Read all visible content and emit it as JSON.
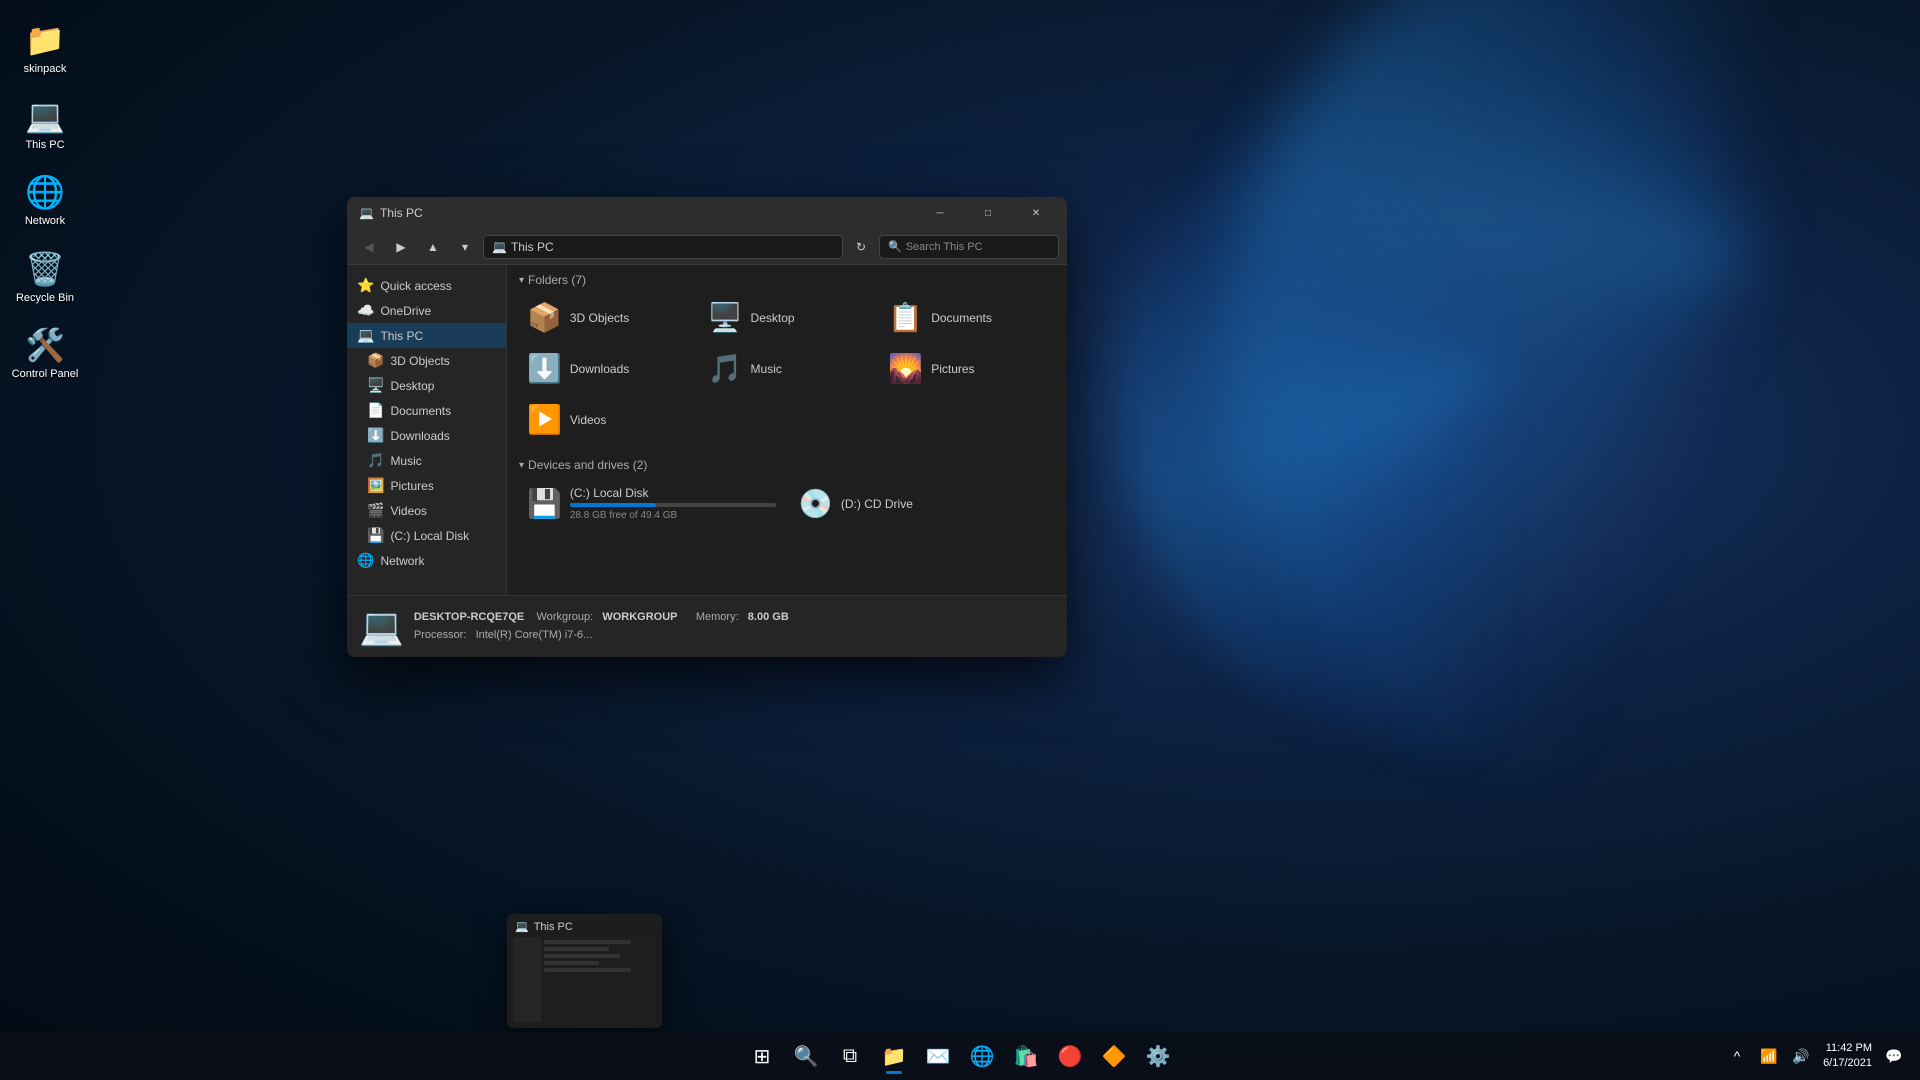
{
  "desktop": {
    "background": "Windows 11 blue swirl",
    "icons": [
      {
        "id": "skinpack",
        "label": "skinpack",
        "emoji": "📁",
        "color": "#f0a030"
      },
      {
        "id": "this-pc",
        "label": "This PC",
        "emoji": "💻"
      },
      {
        "id": "network",
        "label": "Network",
        "emoji": "🌐"
      },
      {
        "id": "recycle-bin",
        "label": "Recycle Bin",
        "emoji": "🗑️"
      },
      {
        "id": "control-panel",
        "label": "Control Panel",
        "emoji": "🛠️"
      }
    ]
  },
  "explorer": {
    "title": "This PC",
    "address": "This PC",
    "search_placeholder": "Search This PC",
    "sidebar": {
      "items": [
        {
          "id": "quick-access",
          "label": "Quick access",
          "icon": "⭐",
          "indent": 0
        },
        {
          "id": "onedrive",
          "label": "OneDrive",
          "icon": "☁️",
          "indent": 1
        },
        {
          "id": "this-pc",
          "label": "This PC",
          "icon": "💻",
          "indent": 1
        },
        {
          "id": "3d-objects",
          "label": "3D Objects",
          "icon": "📦",
          "indent": 2
        },
        {
          "id": "desktop",
          "label": "Desktop",
          "icon": "🖥️",
          "indent": 2
        },
        {
          "id": "documents",
          "label": "Documents",
          "icon": "📄",
          "indent": 2
        },
        {
          "id": "downloads",
          "label": "Downloads",
          "icon": "⬇️",
          "indent": 2
        },
        {
          "id": "music",
          "label": "Music",
          "icon": "🎵",
          "indent": 2
        },
        {
          "id": "pictures",
          "label": "Pictures",
          "icon": "🖼️",
          "indent": 2
        },
        {
          "id": "videos",
          "label": "Videos",
          "icon": "🎬",
          "indent": 2
        },
        {
          "id": "local-disk",
          "label": "(C:) Local Disk",
          "icon": "💾",
          "indent": 2
        },
        {
          "id": "network",
          "label": "Network",
          "icon": "🌐",
          "indent": 1
        }
      ]
    },
    "folders_section": {
      "label": "Folders (7)",
      "items": [
        {
          "id": "3d-objects",
          "label": "3D Objects",
          "emoji": "📦"
        },
        {
          "id": "desktop",
          "label": "Desktop",
          "emoji": "🖥️"
        },
        {
          "id": "documents",
          "label": "Documents",
          "emoji": "📋"
        },
        {
          "id": "downloads",
          "label": "Downloads",
          "emoji": "⬇️"
        },
        {
          "id": "music",
          "label": "Music",
          "emoji": "🎵"
        },
        {
          "id": "pictures",
          "label": "Pictures",
          "emoji": "🌄"
        },
        {
          "id": "videos",
          "label": "Videos",
          "emoji": "▶️"
        }
      ]
    },
    "drives_section": {
      "label": "Devices and drives (2)",
      "items": [
        {
          "id": "c-drive",
          "label": "(C:) Local Disk",
          "space_free": "28.8 GB free of 49.4 GB",
          "used_pct": 42
        },
        {
          "id": "d-drive",
          "label": "(D:) CD Drive",
          "space_free": "",
          "used_pct": 0
        }
      ]
    },
    "statusbar": {
      "computer_name": "DESKTOP-RCQE7QE",
      "workgroup_label": "Workgroup:",
      "workgroup_value": "WORKGROUP",
      "memory_label": "Memory:",
      "memory_value": "8.00 GB",
      "processor_label": "Processor:",
      "processor_value": "Intel(R) Core(TM) i7-6..."
    }
  },
  "taskbar": {
    "preview": {
      "title": "This PC",
      "visible": true
    },
    "buttons": [
      {
        "id": "start",
        "emoji": "⊞",
        "label": "Start"
      },
      {
        "id": "search",
        "emoji": "🔍",
        "label": "Search"
      },
      {
        "id": "widgets",
        "emoji": "⧉",
        "label": "Widgets"
      },
      {
        "id": "file-explorer",
        "emoji": "📁",
        "label": "File Explorer",
        "active": true
      },
      {
        "id": "mail",
        "emoji": "✉️",
        "label": "Mail"
      },
      {
        "id": "edge",
        "emoji": "🌐",
        "label": "Microsoft Edge"
      },
      {
        "id": "store",
        "emoji": "🛍️",
        "label": "Microsoft Store"
      },
      {
        "id": "office",
        "emoji": "🔴",
        "label": "Office"
      },
      {
        "id": "energize",
        "emoji": "🔶",
        "label": "Energize"
      },
      {
        "id": "settings",
        "emoji": "⚙️",
        "label": "Settings"
      }
    ],
    "clock": {
      "time": "11:42 PM",
      "date": "6/17/2021"
    }
  }
}
